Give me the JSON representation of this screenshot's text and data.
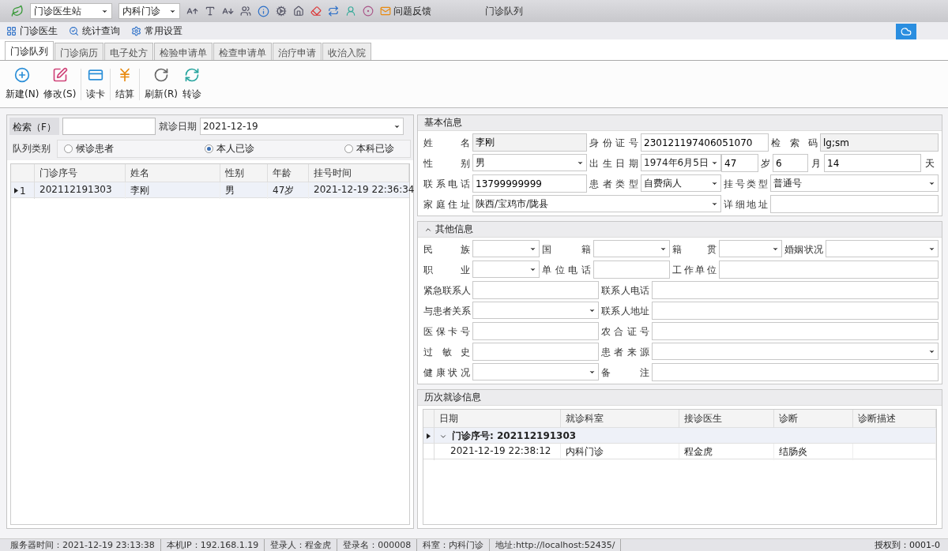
{
  "topbar": {
    "station": "门诊医生站",
    "department": "内科门诊",
    "feedback": "问题反馈",
    "title": "门诊队列"
  },
  "menu": [
    {
      "label": "门诊医生"
    },
    {
      "label": "统计查询"
    },
    {
      "label": "常用设置"
    }
  ],
  "tabs": [
    {
      "label": "门诊队列",
      "selected": true
    },
    {
      "label": "门诊病历",
      "selected": false
    },
    {
      "label": "电子处方",
      "selected": false
    },
    {
      "label": "检验申请单",
      "selected": false
    },
    {
      "label": "检查申请单",
      "selected": false
    },
    {
      "label": "治疗申请",
      "selected": false
    },
    {
      "label": "收治入院",
      "selected": false
    }
  ],
  "actions": [
    {
      "label": "新建(N)"
    },
    {
      "label": "修改(S)"
    },
    {
      "label": "读卡"
    },
    {
      "label": "结算"
    },
    {
      "label": "刷新(R)"
    },
    {
      "label": "转诊"
    }
  ],
  "queue": {
    "search_label": "检索（F）",
    "date_label": "就诊日期",
    "date": "2021-12-19",
    "type_label": "队列类别",
    "types": [
      {
        "label": "候诊患者",
        "selected": false
      },
      {
        "label": "本人已诊",
        "selected": true
      },
      {
        "label": "本科已诊",
        "selected": false
      }
    ],
    "columns": [
      "门诊序号",
      "姓名",
      "性别",
      "年龄",
      "挂号时间"
    ],
    "rows": [
      {
        "number": "1",
        "current": true,
        "cells": [
          "202112191303",
          "李刚",
          "男",
          "47岁",
          "2021-12-19 22:36:34"
        ]
      }
    ]
  },
  "basic_info": {
    "title": "基本信息",
    "lines": [
      {
        "items": [
          {
            "kind": "label",
            "text": "姓名"
          },
          {
            "kind": "readonly",
            "value": "李刚"
          },
          {
            "kind": "label",
            "text": "身份证号"
          },
          {
            "kind": "text",
            "value": "230121197406051070"
          },
          {
            "kind": "label",
            "text": "检索码"
          },
          {
            "kind": "readonly",
            "value": "lg;sm"
          }
        ]
      },
      {
        "items": [
          {
            "kind": "label",
            "text": "性别"
          },
          {
            "kind": "select",
            "value": "男"
          },
          {
            "kind": "label",
            "text": "出生日期"
          },
          {
            "kind": "select",
            "value": "1974年6月5日"
          },
          {
            "kind": "text",
            "value": "47"
          },
          {
            "kind": "unit",
            "text": "岁"
          },
          {
            "kind": "text",
            "value": "6"
          },
          {
            "kind": "unit",
            "text": "月"
          },
          {
            "kind": "text",
            "value": "14"
          },
          {
            "kind": "unit",
            "text": "天"
          }
        ]
      },
      {
        "items": [
          {
            "kind": "label",
            "text": "联系电话"
          },
          {
            "kind": "text",
            "value": "13799999999"
          },
          {
            "kind": "label",
            "text": "患者类型"
          },
          {
            "kind": "select",
            "value": "自费病人"
          },
          {
            "kind": "label",
            "text": "挂号类型"
          },
          {
            "kind": "select",
            "value": "普通号"
          }
        ]
      },
      {
        "items": [
          {
            "kind": "label",
            "text": "家庭住址"
          },
          {
            "kind": "select",
            "value": "陕西/宝鸡市/陇县"
          },
          {
            "kind": "label",
            "text": "详细地址"
          },
          {
            "kind": "text"
          }
        ]
      }
    ]
  },
  "other_info": {
    "title": "其他信息",
    "expanded": true,
    "lines": [
      {
        "items": [
          {
            "kind": "label",
            "text": "民族"
          },
          {
            "kind": "select"
          },
          {
            "kind": "label",
            "text": "国籍"
          },
          {
            "kind": "select"
          },
          {
            "kind": "label",
            "text": "籍贯"
          },
          {
            "kind": "select"
          },
          {
            "kind": "label",
            "text": "婚姻状况"
          },
          {
            "kind": "select"
          }
        ]
      },
      {
        "items": [
          {
            "kind": "label",
            "text": "职业"
          },
          {
            "kind": "select"
          },
          {
            "kind": "label",
            "text": "单位电话"
          },
          {
            "kind": "text"
          },
          {
            "kind": "label",
            "text": "工作单位"
          },
          {
            "kind": "text"
          }
        ]
      },
      {
        "items": [
          {
            "kind": "label",
            "text": "紧急联系人"
          },
          {
            "kind": "text"
          },
          {
            "kind": "label",
            "text": "联系人电话"
          },
          {
            "kind": "text"
          }
        ]
      },
      {
        "items": [
          {
            "kind": "label",
            "text": "与患者关系"
          },
          {
            "kind": "select"
          },
          {
            "kind": "label",
            "text": "联系人地址"
          },
          {
            "kind": "text"
          }
        ]
      },
      {
        "items": [
          {
            "kind": "label",
            "text": "医保卡号"
          },
          {
            "kind": "text"
          },
          {
            "kind": "label",
            "text": "农合证号"
          },
          {
            "kind": "text"
          }
        ]
      },
      {
        "items": [
          {
            "kind": "label",
            "text": "过敏史"
          },
          {
            "kind": "text"
          },
          {
            "kind": "label",
            "text": "患者来源"
          },
          {
            "kind": "select"
          }
        ]
      },
      {
        "items": [
          {
            "kind": "label",
            "text": "健康状况"
          },
          {
            "kind": "select"
          },
          {
            "kind": "label",
            "text": "备注"
          },
          {
            "kind": "text"
          }
        ]
      }
    ]
  },
  "history": {
    "title": "历次就诊信息",
    "columns": [
      "日期",
      "就诊科室",
      "接诊医生",
      "诊断",
      "诊断描述"
    ],
    "groups": [
      {
        "label": "门诊序号: 202112191303",
        "expanded": true,
        "rows": [
          [
            "2021-12-19 22:38:12",
            "内科门诊",
            "程金虎",
            "结肠炎"
          ]
        ]
      }
    ]
  },
  "status_bar": [
    "服务器时间：2021-12-19 23:13:38",
    "本机IP：192.168.1.19",
    "登录人：程金虎",
    "登录名：000008",
    "科室：内科门诊",
    "地址:http://localhost:52435/"
  ],
  "license": "授权到：0001-0"
}
